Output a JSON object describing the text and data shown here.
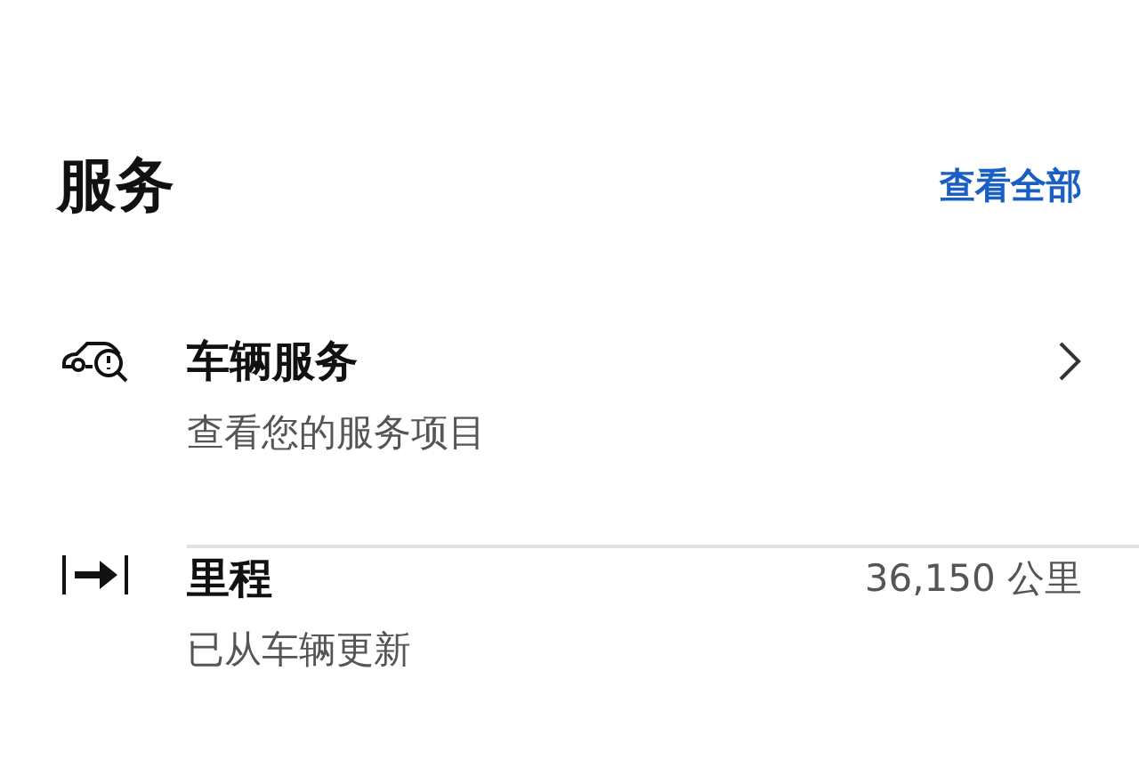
{
  "header": {
    "title": "服务",
    "link": "查看全部"
  },
  "items": [
    {
      "kind": "service",
      "title": "车辆服务",
      "subtitle": "查看您的服务项目"
    },
    {
      "kind": "mileage",
      "title": "里程",
      "subtitle": "已从车辆更新",
      "value": "36,150 公里"
    }
  ]
}
